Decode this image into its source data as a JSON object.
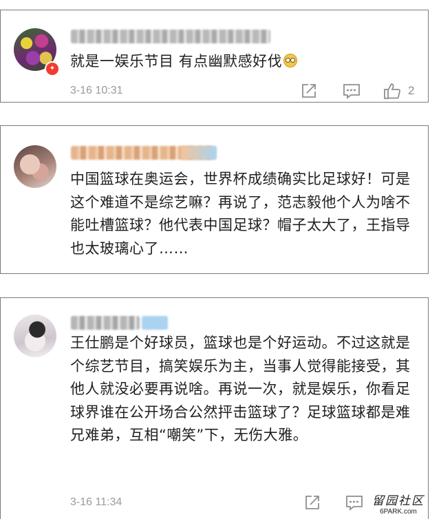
{
  "comments": [
    {
      "text": "就是一娱乐节目 有点幽默感好伐",
      "emoji": "shocked-face-emoji",
      "time": "3-16 10:31",
      "likes": "2",
      "verified_badge": true
    },
    {
      "text": "中国篮球在奥运会，世界杯成绩确实比足球好！可是这个难道不是综艺嘛？再说了，范志毅他个人为啥不能吐槽篮球？他代表中国足球？帽子太大了，王指导也太玻璃心了……"
    },
    {
      "text": "王仕鹏是个好球员，篮球也是个好运动。不过这就是个综艺节目，搞笑娱乐为主，当事人觉得能接受，其他人就没必要再说啥。再说一次，就是娱乐，你看足球界谁在公开场合公然抨击篮球了？足球篮球都是难兄难弟，互相“嘲笑”下，无伤大雅。",
      "time": "3-16 11:34"
    }
  ],
  "icons": {
    "share": "share-icon",
    "reply": "comment-icon",
    "like": "thumbs-up-icon"
  },
  "watermark": {
    "main": "留园社区",
    "site": "6PARK.com"
  },
  "colors": {
    "border": "#7a7a7a",
    "meta_text": "#9a9a9a",
    "badge": "#f23b30"
  }
}
